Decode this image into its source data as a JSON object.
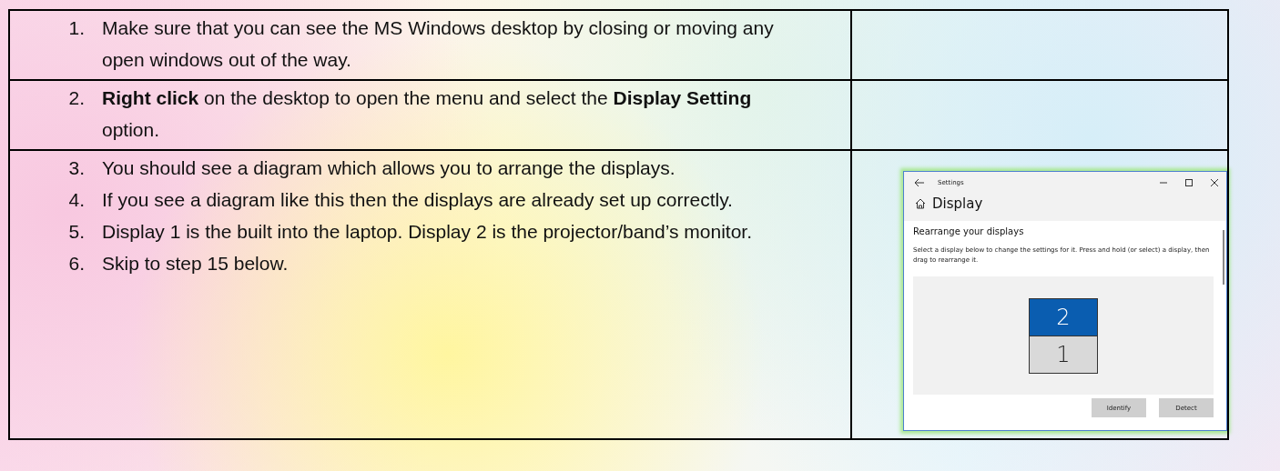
{
  "rows": [
    {
      "steps": [
        {
          "number": "1.",
          "text": "Make sure that you can see the MS Windows desktop by closing or moving any open windows out of the way."
        }
      ]
    },
    {
      "steps": [
        {
          "number": "2.",
          "text": "**Right click** on the desktop to open the menu and select the **Display Setting** option."
        }
      ]
    },
    {
      "steps": [
        {
          "number": "3.",
          "text": "You should see a diagram which allows you to arrange the displays."
        },
        {
          "number": "4.",
          "text": "If you see a diagram like this then the displays are already set up correctly."
        },
        {
          "number": "5.",
          "text": "Display 1 is the built into the laptop.  Display 2 is the projector/band’s monitor."
        },
        {
          "number": "6.",
          "text": "Skip to step 15 below."
        }
      ],
      "screenshot": {
        "title": "Settings",
        "heading": "Display",
        "section": "Rearrange your displays",
        "description": "Select a display below to change the settings for it. Press and hold (or select) a display, then drag to rearrange it.",
        "displays": [
          {
            "label": "2",
            "selected": true
          },
          {
            "label": "1",
            "selected": false
          }
        ],
        "buttons": [
          "Identify",
          "Detect"
        ]
      }
    }
  ]
}
